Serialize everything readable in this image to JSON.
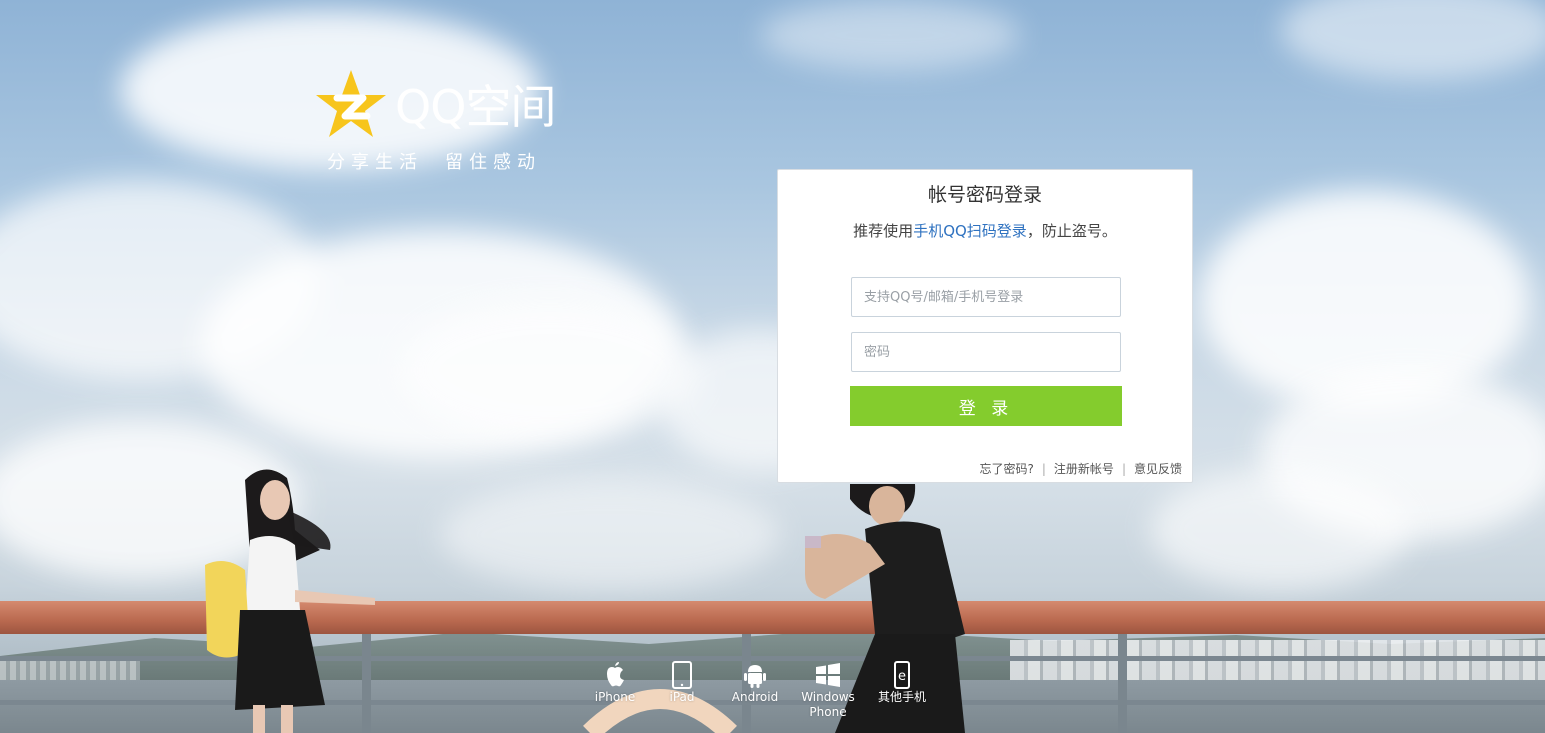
{
  "brand": {
    "logo_text": "QQ空间",
    "slogan_left": "分享生活",
    "slogan_right": "留住感动"
  },
  "login": {
    "title": "帐号密码登录",
    "tip_prefix": "推荐使用",
    "tip_link": "手机QQ扫码登录",
    "tip_suffix": "，防止盗号。",
    "username_placeholder": "支持QQ号/邮箱/手机号登录",
    "password_placeholder": "密码",
    "submit_label": "登 录",
    "links": {
      "forgot": "忘了密码?",
      "register": "注册新帐号",
      "feedback": "意见反馈"
    }
  },
  "platforms": [
    {
      "label": "iPhone",
      "icon": "apple-icon"
    },
    {
      "label": "iPad",
      "icon": "tablet-icon"
    },
    {
      "label": "Android",
      "icon": "android-icon"
    },
    {
      "label": "Windows Phone",
      "icon": "windows-icon"
    },
    {
      "label": "其他手机",
      "icon": "mobile-icon"
    }
  ],
  "colors": {
    "accent_green": "#84cc2d",
    "link_blue": "#2f72c0",
    "logo_yellow": "#f7c51c"
  }
}
